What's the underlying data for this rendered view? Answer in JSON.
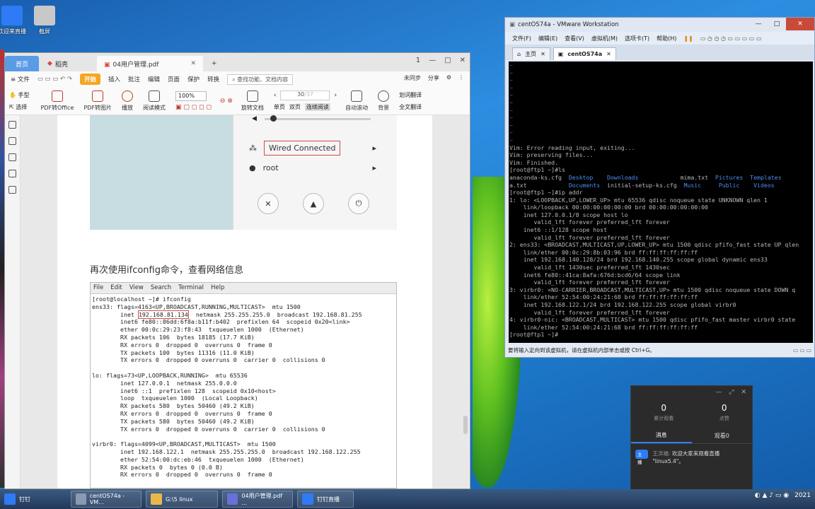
{
  "desktop": {
    "icons": [
      {
        "label": "欢迎来直播"
      },
      {
        "label": "截屏"
      }
    ]
  },
  "wps": {
    "tabs": {
      "home": "首页",
      "wps": "稻壳",
      "doc": "04用户管理.pdf",
      "add": "+"
    },
    "window_controls": {
      "help": "1",
      "min": "—",
      "max": "□",
      "close": "✕"
    },
    "menu": {
      "file": "≡ 文件",
      "start": "开始",
      "insert": "插入",
      "annotate": "批注",
      "edit": "编辑",
      "page": "页面",
      "protect": "保护",
      "convert": "转换",
      "search": "查找功能、文档内容",
      "sync": "未同步",
      "share": "分享"
    },
    "toolbar": {
      "hand": "手型",
      "select": "选择",
      "pdf_office": "PDF转Office",
      "pdf_image": "PDF转图片",
      "play": "播放",
      "read_mode": "阅读模式",
      "zoom": "100%",
      "rotate": "旋转文档",
      "page_value": "30",
      "page_total": "/37",
      "single": "单页",
      "double": "双页",
      "continuous": "连续阅读",
      "autoscroll": "自动滚动",
      "background": "背景",
      "translate": "划词翻译",
      "fulltext": "全文翻译"
    },
    "gnome": {
      "wired": "Wired Connected",
      "root": "root",
      "arrow": "▸"
    },
    "heading": "再次使用ifconfig命令，查看网络信息",
    "terminal_menu": [
      "File",
      "Edit",
      "View",
      "Search",
      "Terminal",
      "Help"
    ],
    "terminal": {
      "l1": "[root@localhost ~]# ifconfig",
      "l2a": "ens33: flags=4163<UP,BROADCAST,RUNNING,MULTICAST>  mtu 1500",
      "l3a": "        inet ",
      "l3ip": "192.168.81.134",
      "l3b": "  netmask 255.255.255.0  broadcast 192.168.81.255",
      "rest": "        inet6 fe80::86dd:6f8a:b11f:b402  prefixlen 64  scopeid 0x20<link>\n        ether 00:0c:29:23:f8:43  txqueuelen 1000  (Ethernet)\n        RX packets 106  bytes 18185 (17.7 KiB)\n        RX errors 0  dropped 0  overruns 0  frame 0\n        TX packets 100  bytes 11316 (11.0 KiB)\n        TX errors 0  dropped 0 overruns 0  carrier 0  collisions 0\n\nlo: flags=73<UP,LOOPBACK,RUNNING>  mtu 65536\n        inet 127.0.0.1  netmask 255.0.0.0\n        inet6 ::1  prefixlen 128  scopeid 0x10<host>\n        loop  txqueuelen 1000  (Local Loopback)\n        RX packets 580  bytes 50460 (49.2 KiB)\n        RX errors 0  dropped 0  overruns 0  frame 0\n        TX packets 580  bytes 50460 (49.2 KiB)\n        TX errors 0  dropped 0 overruns 0  carrier 0  collisions 0\n\nvirbr0: flags=4099<UP,BROADCAST,MULTICAST>  mtu 1500\n        inet 192.168.122.1  netmask 255.255.255.0  broadcast 192.168.122.255\n        ether 52:54:00:dc:eb:46  txqueuelen 1000  (Ethernet)\n        RX packets 0  bytes 0 (0.0 B)\n        RX errors 0  dropped 0  overruns 0  frame 0"
    }
  },
  "vmware": {
    "title": "centOS74a - VMware Workstation",
    "menu": [
      "文件(F)",
      "编辑(E)",
      "查看(V)",
      "虚拟机(M)",
      "选项卡(T)",
      "帮助(H)"
    ],
    "pause": "❚❚",
    "tabs": {
      "home": "主页",
      "vm": "centOS74a",
      "close": "✕"
    },
    "console": {
      "tildes": "~\n~\n~\n~\n~\n~\n~\n~\n~\n~\n~",
      "vim1": "Vim: Error reading input, exiting...",
      "vim2": "Vim: preserving files...",
      "vim3": "Vim: Finished.",
      "ls_cmd": "[root@ftp1 ~]#ls",
      "ls_a": "anaconda-ks.cfg",
      "ls_desktop": "Desktop",
      "ls_downloads": "Downloads",
      "ls_mima": "mima.txt",
      "ls_pictures": "Pictures",
      "ls_templates": "Templates",
      "ls_atxt": "a.txt",
      "ls_documents": "Documents",
      "ls_initial": "initial-setup-ks.cfg",
      "ls_music": "Music",
      "ls_public": "Public",
      "ls_videos": "Videos",
      "ipaddr": "[root@ftp1 ~]#ip addr\n1: lo: <LOOPBACK,UP,LOWER_UP> mtu 65536 qdisc noqueue state UNKNOWN qlen 1\n    link/loopback 00:00:00:00:00:00 brd 00:00:00:00:00:00\n    inet 127.0.0.1/8 scope host lo\n       valid_lft forever preferred_lft forever\n    inet6 ::1/128 scope host\n       valid_lft forever preferred_lft forever\n2: ens33: <BROADCAST,MULTICAST,UP,LOWER_UP> mtu 1500 qdisc pfifo_fast state UP qlen\n    link/ether 00:0c:29:8b:03:96 brd ff:ff:ff:ff:ff:ff\n    inet 192.168.140.128/24 brd 192.168.140.255 scope global dynamic ens33\n       valid_lft 1430sec preferred_lft 1430sec\n    inet6 fe80::41ca:8afa:676d:bcd6/64 scope link\n       valid_lft forever preferred_lft forever\n3: virbr0: <NO-CARRIER,BROADCAST,MULTICAST,UP> mtu 1500 qdisc noqueue state DOWN q\n    link/ether 52:54:00:24:21:68 brd ff:ff:ff:ff:ff:ff\n    inet 192.168.122.1/24 brd 192.168.122.255 scope global virbr0\n       valid_lft forever preferred_lft forever\n4: virbr0-nic: <BROADCAST,MULTICAST> mtu 1500 qdisc pfifo_fast master virbr0 state\n    link/ether 52:54:00:24:21:68 brd ff:ff:ff:ff:ff:ff\n[root@ftp1 ~]#"
    },
    "status": "要将输入定向到该虚拟机，请在虚拟机内部单击或按 Ctrl+G。"
  },
  "live": {
    "viewers_total": "0",
    "viewers_label": "累计观看",
    "likes": "0",
    "likes_label": "点赞",
    "tab_messages": "消息",
    "tab_viewers": "观看0",
    "badge": "主播",
    "sender": "王洪福:",
    "message": "欢迎大家来观看直播 \"linux5.4\"。",
    "ctl_min": "—",
    "ctl_max": "⤢",
    "ctl_close": "✕"
  },
  "taskbar": {
    "items": [
      "钉钉",
      "centOS74a - VM...",
      "G:\\5 linux",
      "04用户管理.pdf ...",
      "钉钉直播"
    ],
    "clock": "2021"
  }
}
